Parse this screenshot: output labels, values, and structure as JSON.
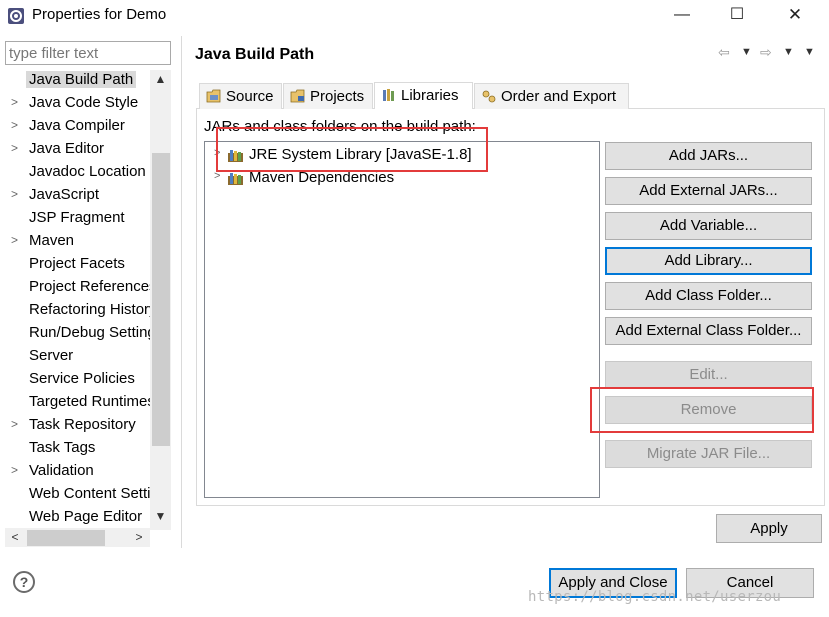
{
  "window": {
    "title": "Properties for Demo",
    "minimize": "—",
    "maximize": "☐",
    "close": "✕"
  },
  "filter": {
    "placeholder": "type filter text"
  },
  "tree": {
    "items": [
      {
        "label": "Java Build Path",
        "expandable": false,
        "selected": true
      },
      {
        "label": "Java Code Style",
        "expandable": true
      },
      {
        "label": "Java Compiler",
        "expandable": true
      },
      {
        "label": "Java Editor",
        "expandable": true
      },
      {
        "label": "Javadoc Location",
        "expandable": false
      },
      {
        "label": "JavaScript",
        "expandable": true
      },
      {
        "label": "JSP Fragment",
        "expandable": false
      },
      {
        "label": "Maven",
        "expandable": true
      },
      {
        "label": "Project Facets",
        "expandable": false
      },
      {
        "label": "Project References",
        "expandable": false
      },
      {
        "label": "Refactoring History",
        "expandable": false
      },
      {
        "label": "Run/Debug Settings",
        "expandable": false
      },
      {
        "label": "Server",
        "expandable": false
      },
      {
        "label": "Service Policies",
        "expandable": false
      },
      {
        "label": "Targeted Runtimes",
        "expandable": false
      },
      {
        "label": "Task Repository",
        "expandable": true
      },
      {
        "label": "Task Tags",
        "expandable": false
      },
      {
        "label": "Validation",
        "expandable": true
      },
      {
        "label": "Web Content Settings",
        "expandable": false
      },
      {
        "label": "Web Page Editor",
        "expandable": false
      }
    ],
    "scroll_up": "▲",
    "scroll_down": "▼",
    "scroll_left": "<",
    "scroll_right": ">"
  },
  "page": {
    "title": "Java Build Path",
    "back_icon": "⇦",
    "forward_icon": "⇨",
    "menu_arrow": "▼"
  },
  "tabs": [
    {
      "label": "Source",
      "icon": "source-folder-icon"
    },
    {
      "label": "Projects",
      "icon": "project-icon"
    },
    {
      "label": "Libraries",
      "icon": "library-icon",
      "active": true
    },
    {
      "label": "Order and Export",
      "icon": "order-export-icon"
    }
  ],
  "libraries": {
    "caption": "JARs and class folders on the build path:",
    "items": [
      {
        "label": "JRE System Library [JavaSE-1.8]",
        "expandable": true
      },
      {
        "label": "Maven Dependencies",
        "expandable": true
      }
    ]
  },
  "buttons": {
    "add_jars": "Add JARs...",
    "add_external_jars": "Add External JARs...",
    "add_variable": "Add Variable...",
    "add_library": "Add Library...",
    "add_class_folder": "Add Class Folder...",
    "add_external_class_folder": "Add External Class Folder...",
    "edit": "Edit...",
    "remove": "Remove",
    "migrate_jar": "Migrate JAR File...",
    "apply": "Apply",
    "apply_and_close": "Apply and Close",
    "cancel": "Cancel"
  },
  "help_icon": "?",
  "watermark": "https://blog.csdn.net/userzou",
  "colors": {
    "annotation_red": "#e33b3b",
    "focus_blue": "#0078d7",
    "button_face": "#e1e1e1"
  }
}
